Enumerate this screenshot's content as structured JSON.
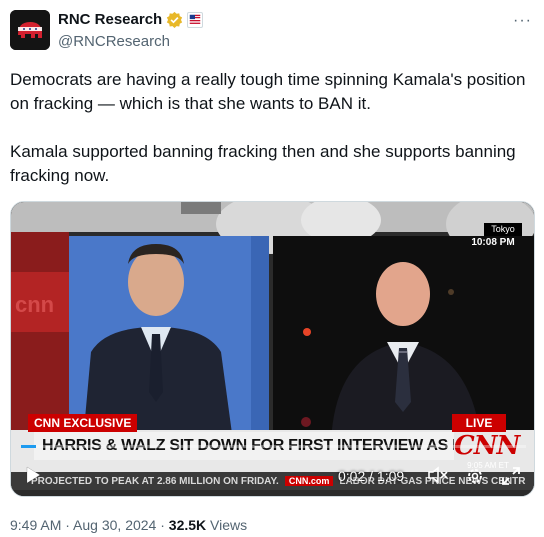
{
  "author": {
    "display_name": "RNC Research",
    "handle": "@RNCResearch",
    "avatar_icon": "elephant-logo-icon",
    "verified_badge_icon": "gold-checkmark-badge-icon",
    "affiliate_icon": "flag-affiliate-icon"
  },
  "more_icon_glyph": "···",
  "tweet": {
    "paragraph_1": "Democrats are having a really tough time spinning Kamala's position on fracking — which is that she wants to BAN it.",
    "paragraph_2": "Kamala supported banning fracking then and she supports banning fracking now."
  },
  "video": {
    "location_tag": "Tokyo",
    "local_time": "10:08 PM",
    "exclusive_label": "CNN EXCLUSIVE",
    "live_label": "LIVE",
    "headline": "HARRIS & WALZ SIT DOWN FOR FIRST INTERVIEW AS DEMOCRATIC TICKET",
    "network_logo": "CNN",
    "network_time": "9:05 AM ET",
    "ticker_left": "PROJECTED TO PEAK AT 2.86 MILLION ON FRIDAY.",
    "ticker_logo": "CNN.com",
    "ticker_right": "LABOR DAY GAS PRICE NEWS CENTR",
    "time_display": "0:02 / 1:09",
    "progress": 0.03,
    "icons": {
      "play": "play-icon",
      "mute": "muted-speaker-icon",
      "settings": "gear-icon",
      "fullscreen": "fullscreen-icon"
    }
  },
  "meta": {
    "time": "9:49 AM",
    "sep1": " · ",
    "date": "Aug 30, 2024",
    "sep2": " · ",
    "views_count": "32.5K",
    "views_label": " Views"
  },
  "colors": {
    "cnn_red": "#cc0000",
    "text_primary": "#0f1419",
    "text_secondary": "#536471",
    "accent": "#1d9bf0",
    "badge_gold": "#e8b829"
  }
}
